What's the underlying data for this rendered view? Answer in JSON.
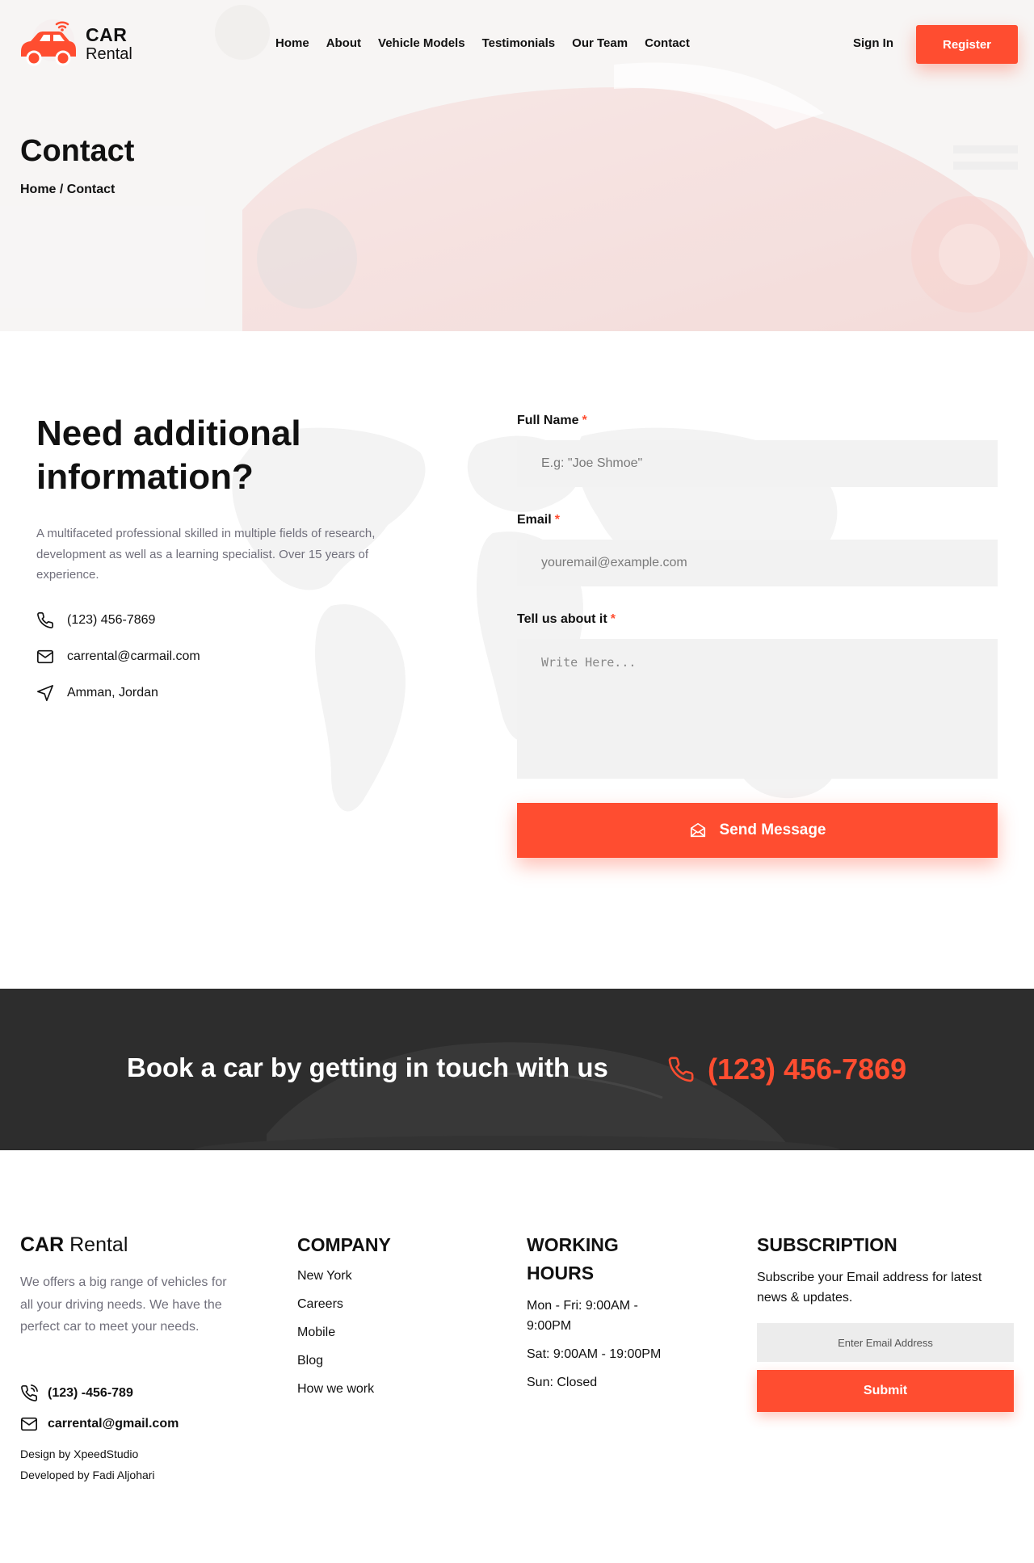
{
  "colors": {
    "accent": "#ff4d30",
    "dark": "#2d2d2d",
    "muted": "#706f7b",
    "field": "#f2f2f2"
  },
  "brand": {
    "line1": "CAR",
    "line2": "Rental"
  },
  "nav": {
    "items": [
      "Home",
      "About",
      "Vehicle Models",
      "Testimonials",
      "Our Team",
      "Contact"
    ]
  },
  "auth": {
    "signin": "Sign In",
    "register": "Register"
  },
  "hero": {
    "title": "Contact",
    "crumb_home": "Home",
    "crumb_sep": " / ",
    "crumb_current": "Contact"
  },
  "contact": {
    "heading": "Need additional information?",
    "description": "A multifaceted professional skilled in multiple fields of research, development as well as a learning specialist. Over 15 years of experience.",
    "phone": "(123) 456-7869",
    "email": "carrental@carmail.com",
    "address": "Amman, Jordan"
  },
  "form": {
    "name_label": "Full Name",
    "name_placeholder": "E.g: \"Joe Shmoe\"",
    "email_label": "Email",
    "email_placeholder": "youremail@example.com",
    "message_label": "Tell us about it",
    "message_placeholder": "Write Here...",
    "required_mark": "*",
    "send_label": "Send Message"
  },
  "banner": {
    "text": "Book a car by getting in touch with us",
    "phone": "(123) 456-7869"
  },
  "footer": {
    "brand_bold": "CAR",
    "brand_light": " Rental",
    "description": "We offers a big range of vehicles for all your driving needs. We have the perfect car to meet your needs.",
    "phone": "(123) -456-789",
    "email": "carrental@gmail.com",
    "design_credit": "Design by XpeedStudio",
    "dev_credit": "Developed by Fadi Aljohari",
    "company_title": "COMPANY",
    "company_links": [
      "New York",
      "Careers",
      "Mobile",
      "Blog",
      "How we work"
    ],
    "hours_title_1": "WORKING",
    "hours_title_2": "HOURS",
    "hours_1": "Mon - Fri: 9:00AM -",
    "hours_1b": "9:00PM",
    "hours_2": "Sat: 9:00AM - 19:00PM",
    "hours_3": "Sun: Closed",
    "subscription_title": "SUBSCRIPTION",
    "subscription_text": "Subscribe your Email address for latest news & updates.",
    "subscription_placeholder": "Enter Email Address",
    "subscription_button": "Submit"
  }
}
